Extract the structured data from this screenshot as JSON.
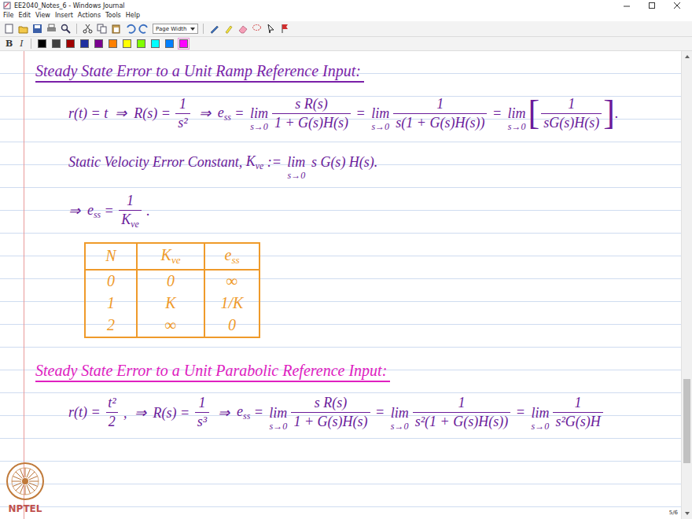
{
  "window": {
    "title": "EE2040_Notes_6 - Windows Journal"
  },
  "menu": [
    "File",
    "Edit",
    "View",
    "Insert",
    "Actions",
    "Tools",
    "Help"
  ],
  "toolbar": {
    "zoom": "Page Width"
  },
  "format_buttons": [
    "B",
    "I"
  ],
  "pen_colors": [
    {
      "color": "#000000",
      "selected": false
    },
    {
      "color": "#404040",
      "selected": false
    },
    {
      "color": "#a00000",
      "selected": false
    },
    {
      "color": "#1f2fa0",
      "selected": false
    },
    {
      "color": "#7a0090",
      "selected": false
    },
    {
      "color": "#ff8000",
      "selected": false
    },
    {
      "color": "#ffff00",
      "selected": false
    },
    {
      "color": "#80ff00",
      "selected": false
    },
    {
      "color": "#00ffff",
      "selected": false
    },
    {
      "color": "#0080ff",
      "selected": false
    },
    {
      "color": "#ff00ff",
      "selected": true
    }
  ],
  "sections": [
    {
      "kind": "heading",
      "color": "#7a1fa8",
      "text": "Steady State Error to a Unit Ramp Reference Input:"
    },
    {
      "kind": "equation",
      "color": "#6a1b9a",
      "tokens": [
        {
          "kind": "text",
          "value": "r(t) = t  ⇒  R(s) = "
        },
        {
          "kind": "frac",
          "num": [
            {
              "kind": "text",
              "value": "1"
            }
          ],
          "den": [
            {
              "kind": "text",
              "value": "s²"
            }
          ]
        },
        {
          "kind": "text",
          "value": "  ⇒  "
        },
        {
          "kind": "sub",
          "base": "e",
          "sub": "ss"
        },
        {
          "kind": "text",
          "value": " = "
        },
        {
          "kind": "lim",
          "top": "lim",
          "bottom": "s→0"
        },
        {
          "kind": "frac",
          "num": [
            {
              "kind": "text",
              "value": "s R(s)"
            }
          ],
          "den": [
            {
              "kind": "text",
              "value": "1 + G(s)H(s)"
            }
          ]
        },
        {
          "kind": "text",
          "value": " = "
        },
        {
          "kind": "lim",
          "top": "lim",
          "bottom": "s→0"
        },
        {
          "kind": "frac",
          "num": [
            {
              "kind": "text",
              "value": "1"
            }
          ],
          "den": [
            {
              "kind": "text",
              "value": "s(1 + G(s)H(s))"
            }
          ]
        },
        {
          "kind": "text",
          "value": " = "
        },
        {
          "kind": "lim",
          "top": "lim",
          "bottom": "s→0"
        },
        {
          "kind": "bracket",
          "open": "[",
          "close": "]",
          "inner": [
            {
              "kind": "frac",
              "num": [
                {
                  "kind": "text",
                  "value": "1"
                }
              ],
              "den": [
                {
                  "kind": "text",
                  "value": "sG(s)H(s)"
                }
              ]
            }
          ]
        },
        {
          "kind": "text",
          "value": "."
        }
      ]
    },
    {
      "kind": "equation",
      "color": "#6a1b9a",
      "tokens": [
        {
          "kind": "text",
          "value": "Static Velocity Error Constant, "
        },
        {
          "kind": "sub",
          "base": "K",
          "sub": "ve"
        },
        {
          "kind": "text",
          "value": " := "
        },
        {
          "kind": "lim",
          "top": "lim",
          "bottom": "s→0"
        },
        {
          "kind": "text",
          "value": " s G(s) H(s)."
        }
      ]
    },
    {
      "kind": "equation",
      "color": "#6a1b9a",
      "tokens": [
        {
          "kind": "text",
          "value": "⇒  "
        },
        {
          "kind": "sub",
          "base": "e",
          "sub": "ss"
        },
        {
          "kind": "text",
          "value": " = "
        },
        {
          "kind": "frac",
          "num": [
            {
              "kind": "text",
              "value": "1"
            }
          ],
          "den": [
            {
              "kind": "sub",
              "base": "K",
              "sub": "ve"
            }
          ]
        },
        {
          "kind": "text",
          "value": " ."
        }
      ]
    },
    {
      "kind": "table",
      "color": "#ef9a2a",
      "columns": [
        [
          {
            "kind": "text",
            "value": "N"
          }
        ],
        [
          {
            "kind": "sub",
            "base": "K",
            "sub": "ve"
          }
        ],
        [
          {
            "kind": "sub",
            "base": "e",
            "sub": "ss"
          }
        ]
      ],
      "rows": [
        [
          "0",
          "0",
          "∞"
        ],
        [
          "1",
          "K",
          "1/K"
        ],
        [
          "2",
          "∞",
          "0"
        ]
      ]
    },
    {
      "kind": "heading",
      "color": "#e020c0",
      "text": "Steady State Error to a Unit Parabolic Reference Input:"
    },
    {
      "kind": "equation",
      "color": "#6a1b9a",
      "tokens": [
        {
          "kind": "text",
          "value": "r(t) = "
        },
        {
          "kind": "frac",
          "num": [
            {
              "kind": "text",
              "value": "t²"
            }
          ],
          "den": [
            {
              "kind": "text",
              "value": "2"
            }
          ]
        },
        {
          "kind": "text",
          "value": " ,  ⇒  R(s) = "
        },
        {
          "kind": "frac",
          "num": [
            {
              "kind": "text",
              "value": "1"
            }
          ],
          "den": [
            {
              "kind": "text",
              "value": "s³"
            }
          ]
        },
        {
          "kind": "text",
          "value": "  ⇒  "
        },
        {
          "kind": "sub",
          "base": "e",
          "sub": "ss"
        },
        {
          "kind": "text",
          "value": " = "
        },
        {
          "kind": "lim",
          "top": "lim",
          "bottom": "s→0"
        },
        {
          "kind": "frac",
          "num": [
            {
              "kind": "text",
              "value": "s R(s)"
            }
          ],
          "den": [
            {
              "kind": "text",
              "value": "1 + G(s)H(s)"
            }
          ]
        },
        {
          "kind": "text",
          "value": " = "
        },
        {
          "kind": "lim",
          "top": "lim",
          "bottom": "s→0"
        },
        {
          "kind": "frac",
          "num": [
            {
              "kind": "text",
              "value": "1"
            }
          ],
          "den": [
            {
              "kind": "text",
              "value": "s²(1 + G(s)H(s))"
            }
          ]
        },
        {
          "kind": "text",
          "value": " = "
        },
        {
          "kind": "lim",
          "top": "lim",
          "bottom": "s→0"
        },
        {
          "kind": "frac",
          "num": [
            {
              "kind": "text",
              "value": "1"
            }
          ],
          "den": [
            {
              "kind": "text",
              "value": "s²G(s)H"
            }
          ]
        }
      ]
    }
  ],
  "logo": "NPTEL",
  "page_indicator": "5/6",
  "scrollbar": {
    "thumb_start": 0.71,
    "thumb_share": 0.19
  }
}
